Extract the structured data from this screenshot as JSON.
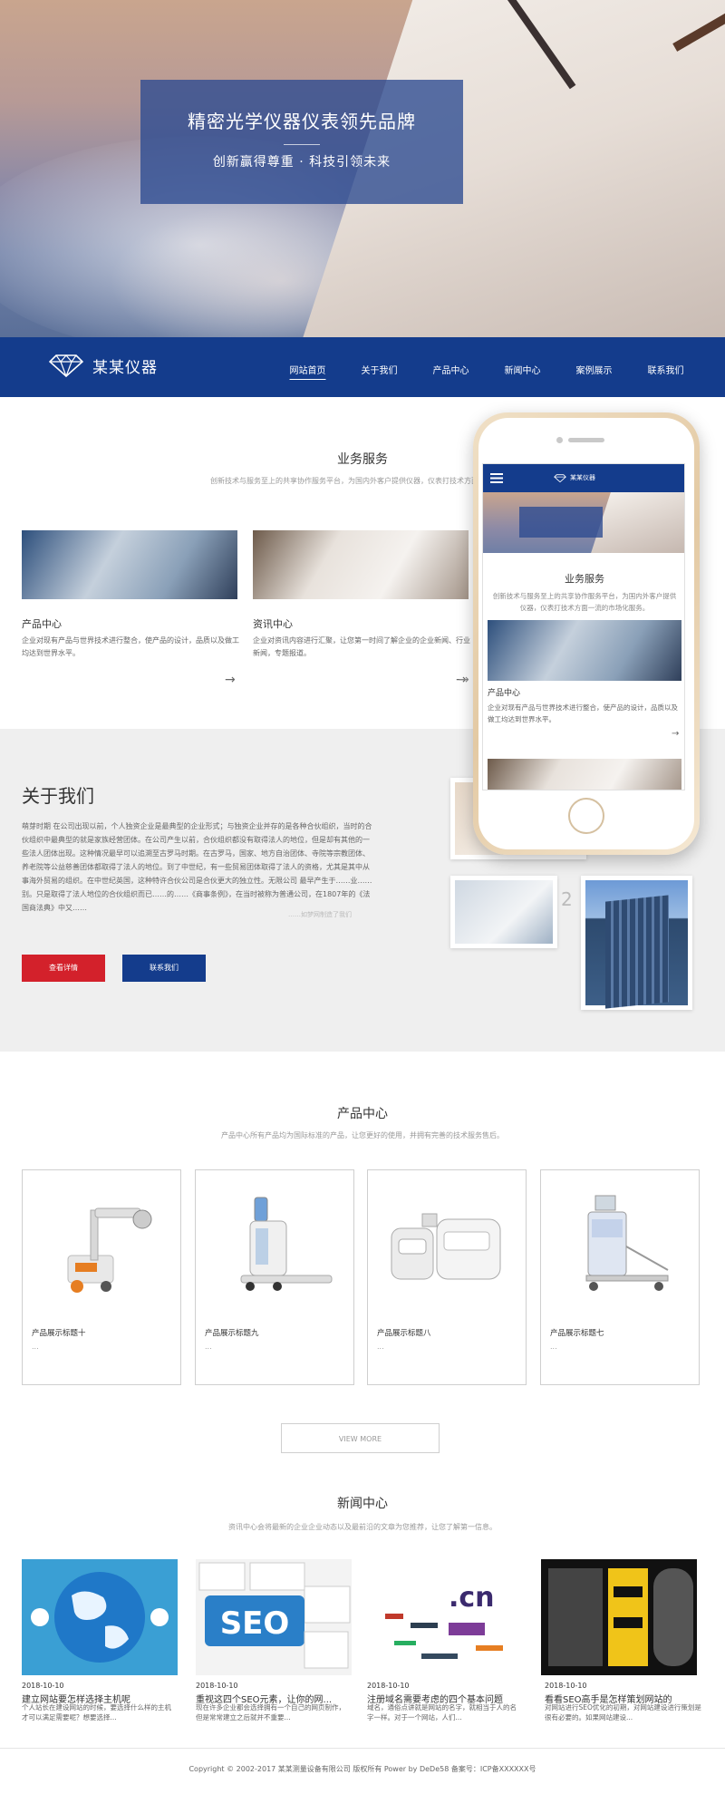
{
  "hero": {
    "title": "精密光学仪器仪表领先品牌",
    "subtitle": "创新赢得尊重 · 科技引领未来"
  },
  "nav": {
    "logo_text": "某某仪器",
    "items": [
      "网站首页",
      "关于我们",
      "产品中心",
      "新闻中心",
      "案例展示",
      "联系我们"
    ]
  },
  "services": {
    "title": "业务服务",
    "subtitle": "创新技术与服务至上的共享协作服务平台，为国内外客户提供仪器，仪表打技术方面",
    "cards": [
      {
        "heading": "产品中心",
        "desc": "企业对现有产品与世界技术进行整合，使产品的设计，品质以及做工均达到世界水平。",
        "arrow": "→"
      },
      {
        "heading": "资讯中心",
        "desc": "企业对资讯内容进行汇聚，让您第一时间了解企业的企业新闻、行业新闻，专题报道。",
        "arrow": "→"
      }
    ],
    "arrow3": "→"
  },
  "phone": {
    "logo_text": "某某仪器",
    "section_title": "业务服务",
    "section_sub": "创新技术与服务至上的共享协作服务平台，为国内外客户提供仪器，仪表打技术方面一流的市场化服务。",
    "card_heading": "产品中心",
    "card_desc": "企业对现有产品与世界技术进行整合，使产品的设计，品质以及做工均达到世界水平。",
    "arrow": "→"
  },
  "about": {
    "title": "关于我们",
    "text": "萌芽时期 在公司出现以前，个人独资企业是最典型的企业形式；与独资企业并存的是各种合伙组织，当时的合伙组织中最典型的就是家族经营团体。在公司产生以前，合伙组织都没有取得法人的地位，但是却有其他的一些法人团体出现。这种情况最早可以追溯至古罗马时期。在古罗马，国家、地方自治团体、寺院等宗教团体、养老院等公益慈善团体都取得了法人的地位。到了中世纪，有一些贸易团体取得了法人的资格，尤其是其中从事海外贸易的组织。在中世纪英国，这种特许合伙公司是合伙更大的独立性。无限公司 最早产生于……业……别。只是取得了法人地位的合伙组织而已……的……《商事条例》，在当时被称为普通公司，在1807年的《法国商法典》中又……",
    "btn_detail": "查看详情",
    "btn_contact": "联系我们",
    "num": "2",
    "blur": "……如梦网制造了我们"
  },
  "products": {
    "title": "产品中心",
    "subtitle": "产品中心所有产品均为国际标准的产品，让您更好的使用，并拥有完善的技术服务售后。",
    "items": [
      {
        "name": "产品展示标题十",
        "dots": "..."
      },
      {
        "name": "产品展示标题九",
        "dots": "..."
      },
      {
        "name": "产品展示标题八",
        "dots": "..."
      },
      {
        "name": "产品展示标题七",
        "dots": "..."
      }
    ],
    "more": "VIEW MORE"
  },
  "news": {
    "title": "新闻中心",
    "subtitle": "资讯中心会将最新的企业企业动态以及最前沿的文章为您推荐，让您了解第一信息。",
    "items": [
      {
        "date": "2018-10-10",
        "title": "建立网站要怎样选择主机呢",
        "desc": "个人站长在建设网站的时候，要选择什么样的主机才可以满足需要呢？想要选择..."
      },
      {
        "date": "2018-10-10",
        "title": "重视这四个SEO元素，让你的网...",
        "desc": "现在许多企业都会选择拥有一个自己的网页制作，但是常常建立之后就并不重要..."
      },
      {
        "date": "2018-10-10",
        "title": "注册域名需要考虑的四个基本问题",
        "desc": "域名，通俗点讲就是网站的名字，就相当于人的名字一样。对于一个网站，人们..."
      },
      {
        "date": "2018-10-10",
        "title": "看看SEO高手是怎样策划网站的",
        "desc": "对网站进行SEO优化的初期，对网站建设进行策划是很有必要的。如果网站建设..."
      }
    ],
    "seo_word": "SEO",
    "cn_word": ".cn"
  },
  "footer": {
    "text": "Copyright © 2002-2017 某某测量设备有限公司 版权所有 Power by DeDe58 备案号：ICP备XXXXXX号"
  }
}
